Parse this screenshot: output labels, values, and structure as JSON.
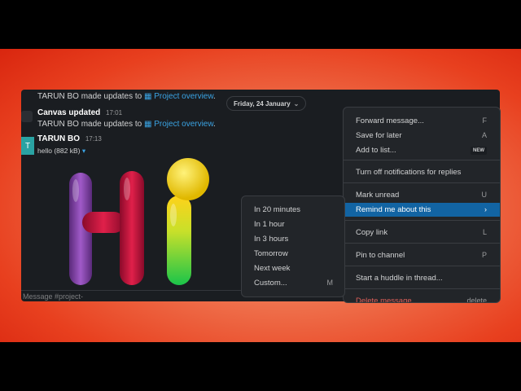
{
  "feed": {
    "update1": {
      "author": "TARUN BO",
      "text": "made updates to",
      "link": "Project overview",
      "suffix": "."
    },
    "canvas": {
      "title": "Canvas updated",
      "time": "17:01"
    },
    "update2": {
      "author": "TARUN BO",
      "text": "made updates to",
      "link": "Project overview",
      "suffix": "."
    },
    "post": {
      "avatar": "T",
      "author": "TARUN BO",
      "time": "17:13",
      "file": "hello (882 kB)",
      "chevron": "▾"
    },
    "date_pill": "Friday, 24 January",
    "date_chevron": "⌄"
  },
  "composer": {
    "placeholder": "Message #project-"
  },
  "context_menu": {
    "items": [
      {
        "label": "Forward message...",
        "shortcut": "F"
      },
      {
        "label": "Save for later",
        "shortcut": "A"
      },
      {
        "label": "Add to list...",
        "badge": "NEW"
      },
      {
        "label": "Turn off notifications for replies"
      },
      {
        "label": "Mark unread",
        "shortcut": "U"
      },
      {
        "label": "Remind me about this",
        "shortcut": "›"
      },
      {
        "label": "Copy link",
        "shortcut": "L"
      },
      {
        "label": "Pin to channel",
        "shortcut": "P"
      },
      {
        "label": "Start a huddle in thread..."
      },
      {
        "label": "Delete message",
        "shortcut": "delete"
      }
    ]
  },
  "remind_submenu": {
    "items": [
      {
        "label": "In 20 minutes"
      },
      {
        "label": "In 1 hour"
      },
      {
        "label": "In 3 hours"
      },
      {
        "label": "Tomorrow"
      },
      {
        "label": "Next week"
      },
      {
        "label": "Custom...",
        "shortcut": "M"
      }
    ]
  },
  "colors": {
    "accent": "#1264a3",
    "link": "#3aa3e3",
    "background": "#1a1d21",
    "menu": "#222529"
  }
}
